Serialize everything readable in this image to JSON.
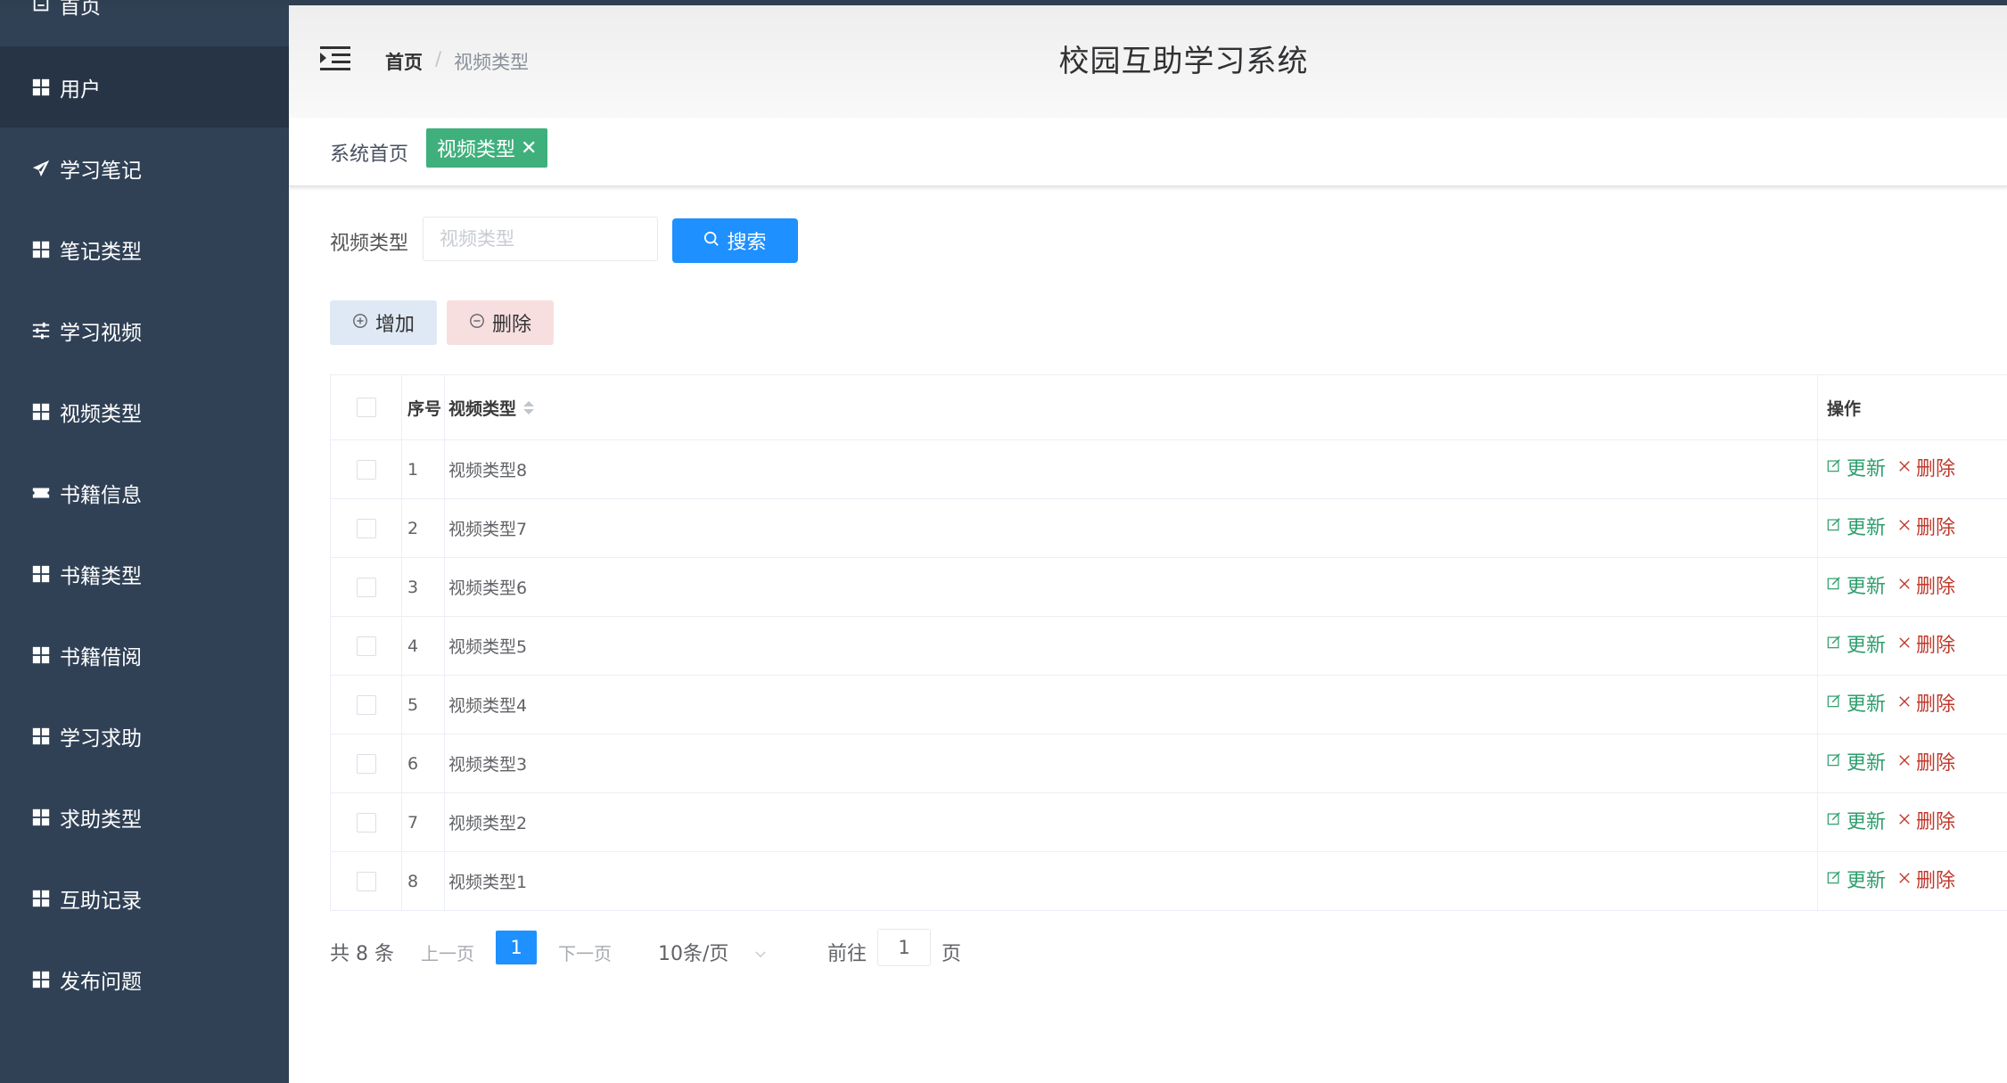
{
  "app": {
    "title": "校园互助学习系统"
  },
  "sidebar": {
    "items": [
      {
        "label": "首页",
        "icon": "home-icon"
      },
      {
        "label": "用户",
        "icon": "grid-icon",
        "active": true
      },
      {
        "label": "学习笔记",
        "icon": "send-icon"
      },
      {
        "label": "笔记类型",
        "icon": "grid-icon"
      },
      {
        "label": "学习视频",
        "icon": "sliders-icon"
      },
      {
        "label": "视频类型",
        "icon": "grid-icon"
      },
      {
        "label": "书籍信息",
        "icon": "ticket-icon"
      },
      {
        "label": "书籍类型",
        "icon": "grid-icon"
      },
      {
        "label": "书籍借阅",
        "icon": "grid-icon"
      },
      {
        "label": "学习求助",
        "icon": "grid-icon"
      },
      {
        "label": "求助类型",
        "icon": "grid-icon"
      },
      {
        "label": "互助记录",
        "icon": "grid-icon"
      },
      {
        "label": "发布问题",
        "icon": "grid-icon"
      }
    ]
  },
  "breadcrumb": {
    "home": "首页",
    "separator": "/",
    "current": "视频类型"
  },
  "tags": {
    "home": "系统首页",
    "active": "视频类型",
    "close": "✕"
  },
  "search": {
    "label": "视频类型",
    "placeholder": "视频类型",
    "value": "",
    "button": "搜索"
  },
  "actions": {
    "add": "增加",
    "delete": "删除"
  },
  "table": {
    "columns": {
      "index": "序号",
      "type": "视频类型",
      "ops": "操作"
    },
    "rows": [
      {
        "index": "1",
        "type": "视频类型8"
      },
      {
        "index": "2",
        "type": "视频类型7"
      },
      {
        "index": "3",
        "type": "视频类型6"
      },
      {
        "index": "4",
        "type": "视频类型5"
      },
      {
        "index": "5",
        "type": "视频类型4"
      },
      {
        "index": "6",
        "type": "视频类型3"
      },
      {
        "index": "7",
        "type": "视频类型2"
      },
      {
        "index": "8",
        "type": "视频类型1"
      }
    ],
    "row_update": "更新",
    "row_delete": "删除"
  },
  "pagination": {
    "total": "共 8 条",
    "prev": "上一页",
    "current": "1",
    "next": "下一页",
    "page_size": "10条/页",
    "goto": "前往",
    "goto_value": "1",
    "unit": "页"
  },
  "colors": {
    "sidebar_bg": "#304156",
    "primary": "#1e90ff",
    "tag_active": "#3fb07c",
    "update": "#2f9e6e",
    "delete": "#c0392b"
  }
}
